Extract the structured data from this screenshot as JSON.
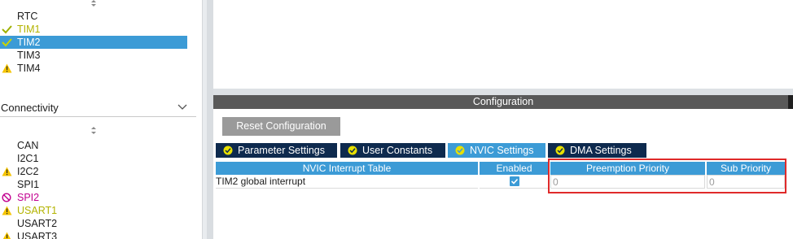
{
  "tree_top": {
    "items": [
      {
        "label": "RTC",
        "status": "none"
      },
      {
        "label": "TIM1",
        "status": "ok"
      },
      {
        "label": "TIM2",
        "status": "ok",
        "selected": true
      },
      {
        "label": "TIM3",
        "status": "none"
      },
      {
        "label": "TIM4",
        "status": "warning"
      }
    ]
  },
  "connectivity": {
    "title": "Connectivity",
    "items": [
      {
        "label": "CAN",
        "status": "none"
      },
      {
        "label": "I2C1",
        "status": "none"
      },
      {
        "label": "I2C2",
        "status": "warning"
      },
      {
        "label": "SPI1",
        "status": "none"
      },
      {
        "label": "SPI2",
        "status": "disabled"
      },
      {
        "label": "USART1",
        "status": "warning"
      },
      {
        "label": "USART2",
        "status": "none"
      },
      {
        "label": "USART3",
        "status": "warning"
      }
    ]
  },
  "configuration": {
    "title": "Configuration",
    "reset_label": "Reset Configuration",
    "tabs": [
      {
        "label": "Parameter Settings",
        "active": false
      },
      {
        "label": "User Constants",
        "active": false
      },
      {
        "label": "NVIC Settings",
        "active": true
      },
      {
        "label": "DMA Settings",
        "active": false
      }
    ],
    "table": {
      "headers": [
        "NVIC Interrupt Table",
        "Enabled",
        "Preemption Priority",
        "Sub Priority"
      ],
      "rows": [
        {
          "name": "TIM2 global interrupt",
          "enabled": true,
          "preemption": "0",
          "sub": "0"
        }
      ]
    }
  },
  "colors": {
    "accent": "#3c9bd6",
    "tab_dark": "#0e2a4e",
    "ok": "#b3b300",
    "warning": "#f5c400",
    "disabled": "#c2008f",
    "highlight": "#e02a2a"
  }
}
